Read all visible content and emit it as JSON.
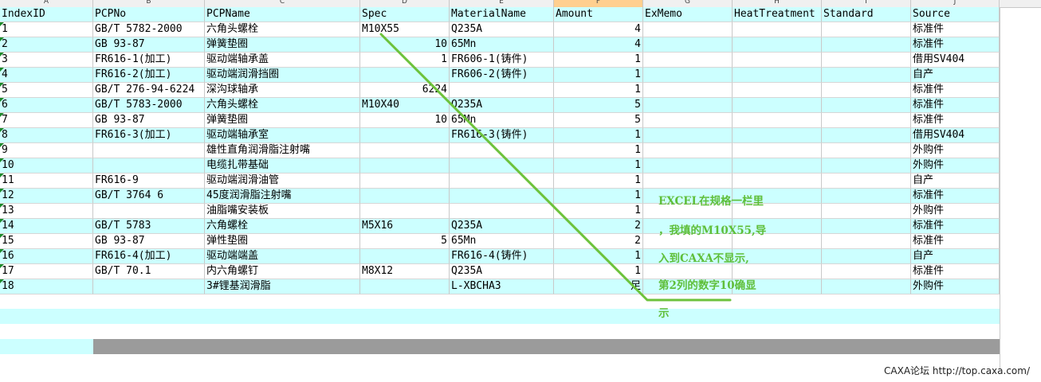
{
  "sheet": {
    "column_letters": [
      "A",
      "B",
      "C",
      "D",
      "E",
      "F",
      "G",
      "H",
      "I",
      "J"
    ],
    "selected_column": "F",
    "headers": [
      "IndexID",
      "PCPNo",
      "PCPName",
      "Spec",
      "MaterialName",
      "Amount",
      "ExMemo",
      "HeatTreatment",
      "Standard",
      "Source"
    ],
    "rows": [
      [
        "1",
        "GB/T 5782-2000",
        "六角头螺栓",
        "M10X55",
        "Q235A",
        "4",
        "",
        "",
        "",
        "标准件"
      ],
      [
        "2",
        "GB 93-87",
        "弹簧垫圈",
        "10",
        "65Mn",
        "4",
        "",
        "",
        "",
        "标准件"
      ],
      [
        "3",
        "FR616-1(加工)",
        "驱动端轴承盖",
        "1",
        "FR606-1(铸件)",
        "1",
        "",
        "",
        "",
        "借用SV404"
      ],
      [
        "4",
        "FR616-2(加工)",
        "驱动端润滑挡圈",
        "",
        "FR606-2(铸件)",
        "1",
        "",
        "",
        "",
        "自产"
      ],
      [
        "5",
        "GB/T 276-94-6224",
        "深沟球轴承",
        "6224",
        "",
        "1",
        "",
        "",
        "",
        "标准件"
      ],
      [
        "6",
        "GB/T 5783-2000",
        "六角头螺栓",
        "M10X40",
        "Q235A",
        "5",
        "",
        "",
        "",
        "标准件"
      ],
      [
        "7",
        "GB 93-87",
        "弹簧垫圈",
        "10",
        "65Mn",
        "5",
        "",
        "",
        "",
        "标准件"
      ],
      [
        "8",
        "FR616-3(加工)",
        "驱动端轴承室",
        "",
        "FR616-3(铸件)",
        "1",
        "",
        "",
        "",
        "借用SV404"
      ],
      [
        "9",
        "",
        "雄性直角润滑脂注射嘴",
        "",
        "",
        "1",
        "",
        "",
        "",
        "外购件"
      ],
      [
        "10",
        "",
        "电缆扎带基础",
        "",
        "",
        "1",
        "",
        "",
        "",
        "外购件"
      ],
      [
        "11",
        "FR616-9",
        "驱动端润滑油管",
        "",
        "",
        "1",
        "",
        "",
        "",
        "自产"
      ],
      [
        "12",
        "GB/T 3764 6",
        "45度润滑脂注射嘴",
        "",
        "",
        "1",
        "",
        "",
        "",
        "标准件"
      ],
      [
        "13",
        "",
        "油脂嘴安装板",
        "",
        "",
        "1",
        "",
        "",
        "",
        "外购件"
      ],
      [
        "14",
        "GB/T 5783",
        "六角螺栓",
        "M5X16",
        "Q235A",
        "2",
        "",
        "",
        "",
        "标准件"
      ],
      [
        "15",
        "GB 93-87",
        "弹性垫圈",
        "5",
        "65Mn",
        "2",
        "",
        "",
        "",
        "标准件"
      ],
      [
        "16",
        "FR616-4(加工)",
        "驱动端端盖",
        "",
        "FR616-4(铸件)",
        "1",
        "",
        "",
        "",
        "自产"
      ],
      [
        "17",
        "GB/T 70.1",
        "内六角螺钉",
        "M8X12",
        "Q235A",
        "1",
        "",
        "",
        "",
        "标准件"
      ],
      [
        "18",
        "",
        "3#锂基润滑脂",
        "",
        "L-XBCHA3",
        "足",
        "",
        "",
        "",
        "外购件"
      ]
    ]
  },
  "annotation": {
    "lines": [
      "EXCEL在规格一栏里",
      "，我填的M10X55,导",
      "入到CAXA不显示,",
      "第2列的数字10确显",
      "示"
    ],
    "color": "#5fbf3a"
  },
  "footer": {
    "text": "CAXA论坛 http://top.caxa.com/"
  }
}
